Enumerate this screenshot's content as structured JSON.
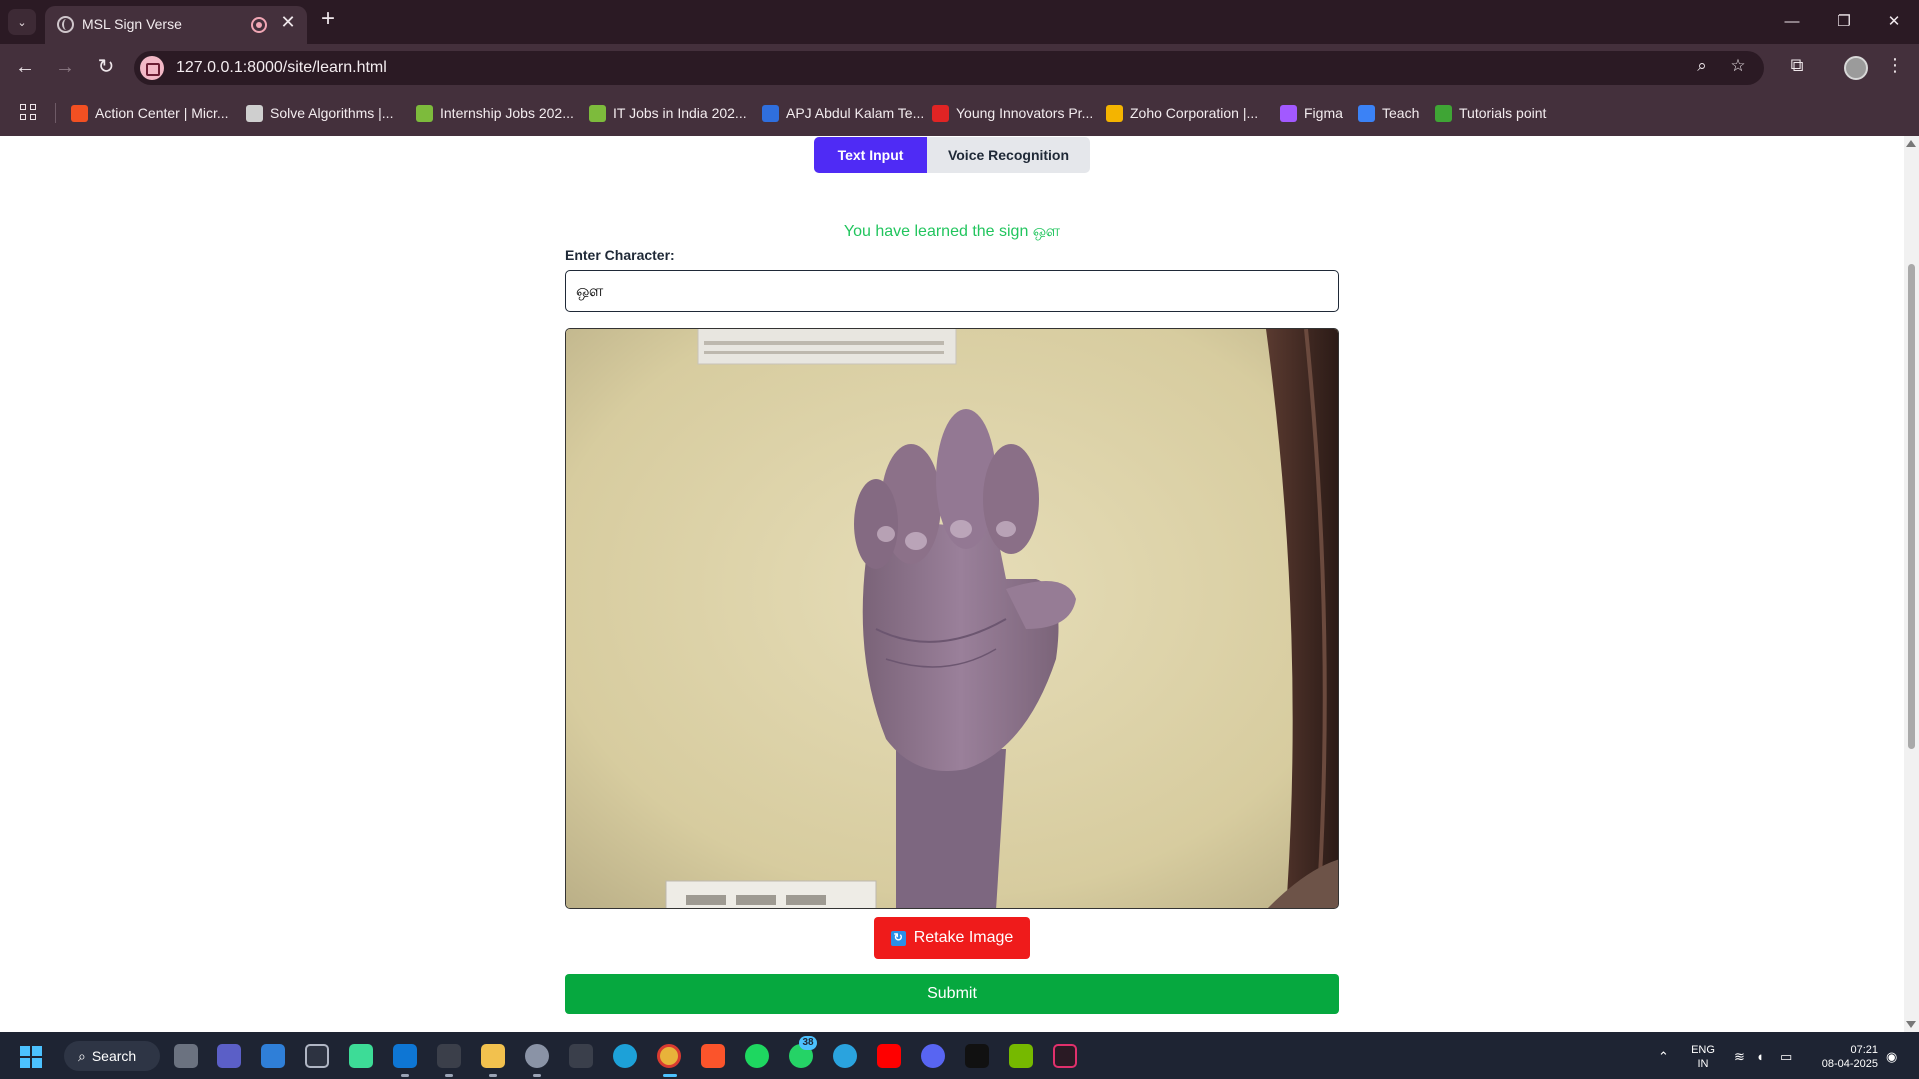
{
  "browser": {
    "tab_title": "MSL Sign Verse",
    "url": "127.0.0.1:8000/site/learn.html",
    "new_tab_glyph": "+",
    "close_glyph": "✕",
    "window_controls": {
      "minimize": "—",
      "restore": "❐",
      "close": "✕"
    },
    "nav": {
      "back": "←",
      "forward": "→",
      "reload": "↻"
    },
    "icons": [
      "search-tabs-icon",
      "zoom-icon",
      "bookmark-star-icon",
      "extensions-icon",
      "profile-avatar",
      "menu-dots-icon"
    ]
  },
  "bookmarks": [
    {
      "label": "Action Center | Micr...",
      "color": "#f25022"
    },
    {
      "label": "Solve Algorithms |...",
      "color": "#cfcfcf"
    },
    {
      "label": "Internship Jobs 202...",
      "color": "#7dbb3c"
    },
    {
      "label": "IT Jobs in India 202...",
      "color": "#7dbb3c"
    },
    {
      "label": "APJ Abdul Kalam Te...",
      "color": "#2f6fde"
    },
    {
      "label": "Young Innovators Pr...",
      "color": "#e02424"
    },
    {
      "label": "Zoho Corporation |...",
      "color": "#f4b400"
    },
    {
      "label": "Figma",
      "color": "#a259ff"
    },
    {
      "label": "Teach",
      "color": "#3b82f6"
    },
    {
      "label": "Tutorials point",
      "color": "#3fa535"
    }
  ],
  "page": {
    "tabs": {
      "text_input": "Text Input",
      "voice_recognition": "Voice Recognition"
    },
    "success_message": "You have learned the sign ஔ",
    "input_label": "Enter Character:",
    "input_value": "ஔ",
    "retake_label": "Retake Image",
    "retake_icon_glyph": "↻",
    "submit_label": "Submit",
    "accent_color": "#4f2bf5",
    "success_color": "#22c55e",
    "retake_color": "#ef1b1b",
    "submit_color": "#06a83f"
  },
  "taskbar": {
    "search_label": "Search",
    "search_glyph": "⌕",
    "whatsapp_badge": "38",
    "language": "ENG",
    "region": "IN",
    "time": "07:21",
    "date": "08-04-2025",
    "tray_chevron": "⌃",
    "tray_icons": {
      "wifi": "≋",
      "volume": "◖",
      "battery": "▭",
      "bell": "◉"
    }
  }
}
